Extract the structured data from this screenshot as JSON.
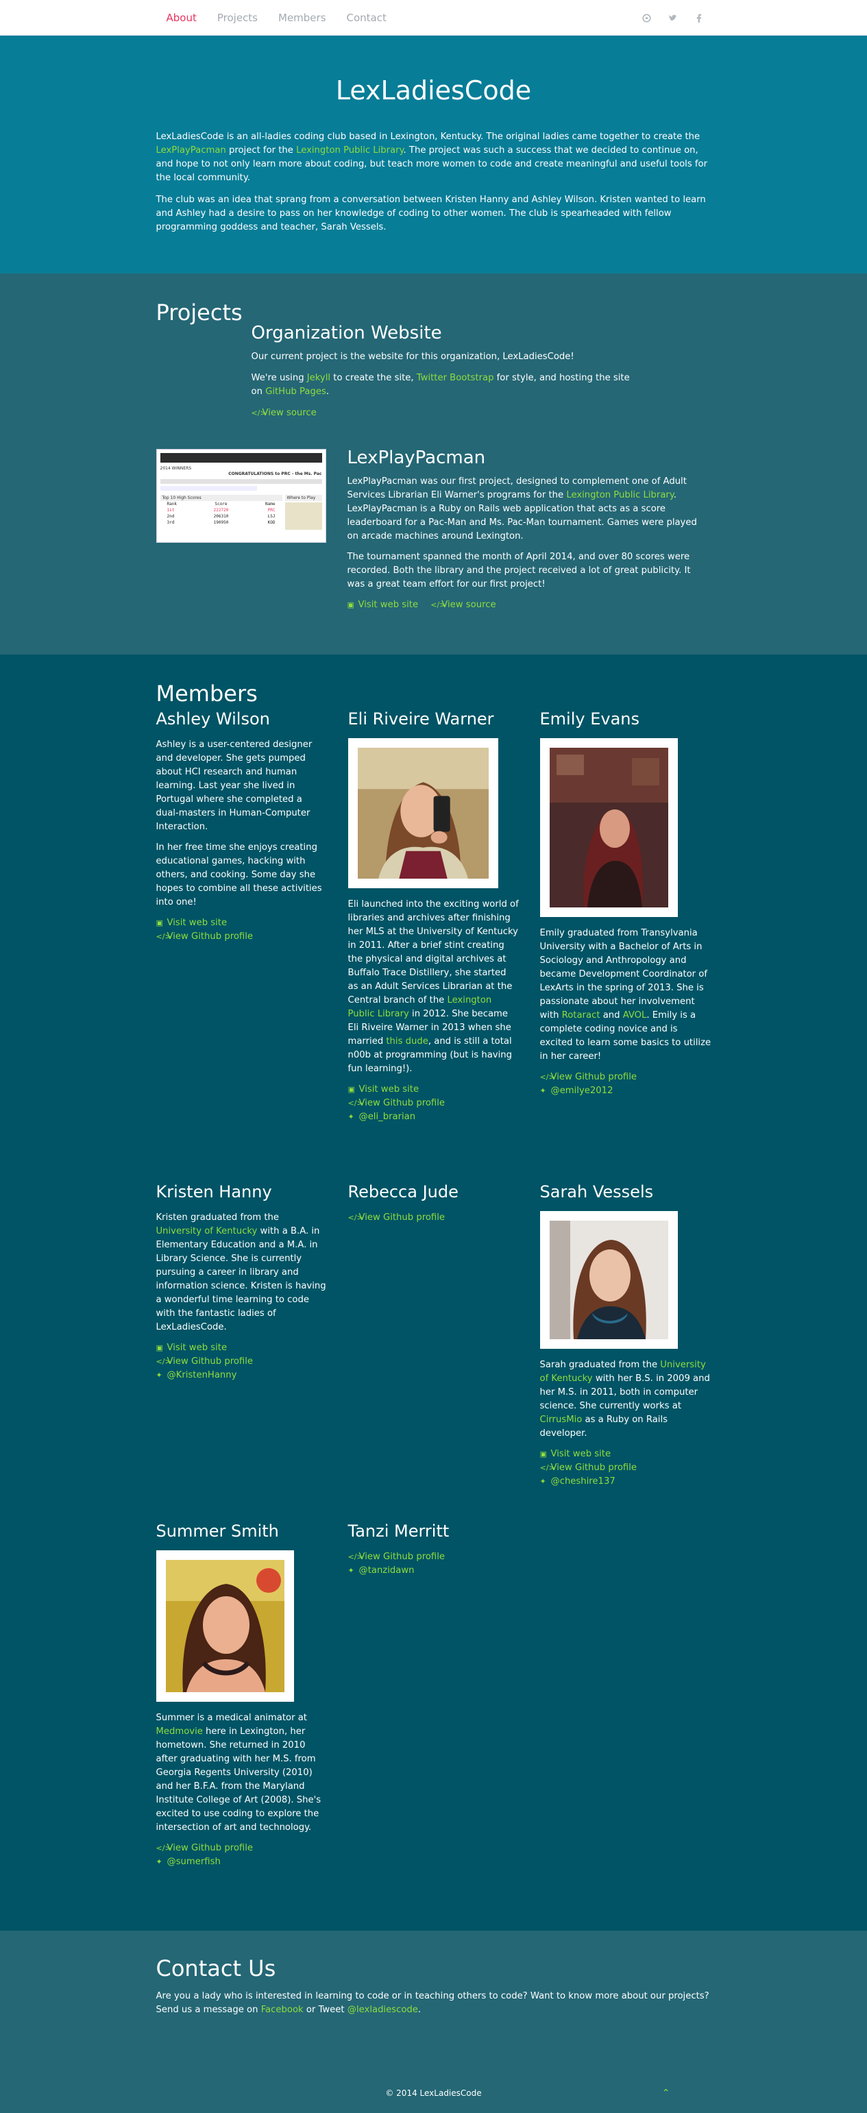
{
  "nav": {
    "items": [
      "About",
      "Projects",
      "Members",
      "Contact"
    ],
    "social": [
      "github-icon",
      "twitter-icon",
      "facebook-icon"
    ]
  },
  "hero": {
    "title": "LexLadiesCode",
    "p1_a": "LexLadiesCode is an all-ladies coding club based in Lexington, Kentucky. The original ladies came together to create the ",
    "p1_link1": "LexPlayPacman",
    "p1_b": " project for the ",
    "p1_link2": "Lexington Public Library",
    "p1_c": ". The project was such a success that we decided to continue on, and hope to not only learn more about coding, but teach more women to code and create meaningful and useful tools for the local community.",
    "p2": "The club was an idea that sprang from a conversation between Kristen Hanny and Ashley Wilson. Kristen wanted to learn and Ashley had a desire to pass on her knowledge of coding to other women. The club is spearheaded with fellow programming goddess and teacher, Sarah Vessels."
  },
  "projects": {
    "title": "Projects",
    "org": {
      "title": "Organization Website",
      "p1": "Our current project is the website for this organization, LexLadiesCode!",
      "p2_a": "We're using ",
      "p2_link1": "Jekyll",
      "p2_b": " to create the site, ",
      "p2_link2": "Twitter Bootstrap",
      "p2_c": " for style, and hosting the site on ",
      "p2_link3": "GitHub Pages",
      "p2_d": ".",
      "source": "View source"
    },
    "pacman": {
      "title": "LexPlayPacman",
      "p1_a": "LexPlayPacman was our first project, designed to complement one of Adult Services Librarian Eli Warner's programs for the ",
      "p1_link": "Lexington Public Library",
      "p1_b": ". LexPlayPacman is a Ruby on Rails web application that acts as a score leaderboard for a Pac-Man and Ms. Pac-Man tournament. Games were played on arcade machines around Lexington.",
      "p2": "The tournament spanned the month of April 2014, and over 80 scores were recorded. Both the library and the project received a lot of great publicity. It was a great team effort for our first project!",
      "site": "Visit web site",
      "source": "View source",
      "shot": {
        "heading": "2014 WINNERS",
        "banner": "CONGRATULATIONS to PRC - the Ms. Pac",
        "table_title": "Top 10 High Scores",
        "side": "Where to Play",
        "cols": [
          "Rank",
          "Score",
          "Name"
        ],
        "rows": [
          [
            "1st",
            "222720",
            "PRC"
          ],
          [
            "2nd",
            "206310",
            "LSJ"
          ],
          [
            "3rd",
            "190950",
            "KOD"
          ]
        ]
      }
    }
  },
  "members": {
    "title": "Members",
    "ashley": {
      "name": "Ashley Wilson",
      "p1": "Ashley is a user-centered designer and developer. She gets pumped about HCI research and human learning. Last year she lived in Portugal where she completed a dual-masters in Human-Computer Interaction.",
      "p2": "In her free time she enjoys creating educational games, hacking with others, and cooking. Some day she hopes to combine all these activities into one!",
      "site": "Visit web site",
      "github": "View Github profile"
    },
    "eli": {
      "name": "Eli Riveire Warner",
      "p_a": "Eli launched into the exciting world of libraries and archives after finishing her MLS at the University of Kentucky in 2011. After a brief stint creating the physical and digital archives at Buffalo Trace Distillery, she started as an Adult Services Librarian at the Central branch of the ",
      "p_link1": "Lexington Public Library",
      "p_b": " in 2012. She became Eli Riveire Warner in 2013 when she married ",
      "p_link2": "this dude",
      "p_c": ", and is still a total n00b at programming (but is having fun learning!).",
      "site": "Visit web site",
      "github": "View Github profile",
      "twitter": "@eli_brarian"
    },
    "emily": {
      "name": "Emily Evans",
      "p_a": "Emily graduated from Transylvania University with a Bachelor of Arts in Sociology and Anthropology and became Development Coordinator of LexArts in the spring of 2013. She is passionate about her involvement with ",
      "p_link1": "Rotaract",
      "p_b": " and ",
      "p_link2": "AVOL",
      "p_c": ". Emily is a complete coding novice and is excited to learn some basics to utilize in her career!",
      "github": "View Github profile",
      "twitter": "@emilye2012"
    },
    "kristen": {
      "name": "Kristen Hanny",
      "p_a": "Kristen graduated from the ",
      "p_link": "University of Kentucky",
      "p_b": " with a B.A. in Elementary Education and a M.A. in Library Science. She is currently pursuing a career in library and information science. Kristen is having a wonderful time learning to code with the fantastic ladies of LexLadiesCode.",
      "site": "Visit web site",
      "github": "View Github profile",
      "twitter": "@KristenHanny"
    },
    "rebecca": {
      "name": "Rebecca Jude",
      "github": "View Github profile"
    },
    "sarah": {
      "name": "Sarah Vessels",
      "p_a": "Sarah graduated from the ",
      "p_link1": "University of Kentucky",
      "p_b": " with her B.S. in 2009 and her M.S. in 2011, both in computer science. She currently works at ",
      "p_link2": "CirrusMio",
      "p_c": " as a Ruby on Rails developer.",
      "site": "Visit web site",
      "github": "View Github profile",
      "twitter": "@cheshire137"
    },
    "summer": {
      "name": "Summer Smith",
      "p_a": "Summer is a medical animator at ",
      "p_link": "Medmovie",
      "p_b": " here in Lexington, her hometown. She returned in 2010 after graduating with her M.S. from Georgia Regents University (2010) and her B.F.A. from the Maryland Institute College of Art (2008). She's excited to use coding to explore the intersection of art and technology.",
      "github": "View Github profile",
      "twitter": "@sumerfish"
    },
    "tanzi": {
      "name": "Tanzi Merritt",
      "github": "View Github profile",
      "twitter": "@tanzidawn"
    }
  },
  "contact": {
    "title": "Contact Us",
    "p_a": "Are you a lady who is interested in learning to code or in teaching others to code? Want to know more about our projects? Send us a message on ",
    "p_link1": "Facebook",
    "p_b": " or Tweet ",
    "p_link2": "@lexladiescode",
    "p_c": "."
  },
  "footer": {
    "copyright": "© 2014 LexLadiesCode"
  }
}
